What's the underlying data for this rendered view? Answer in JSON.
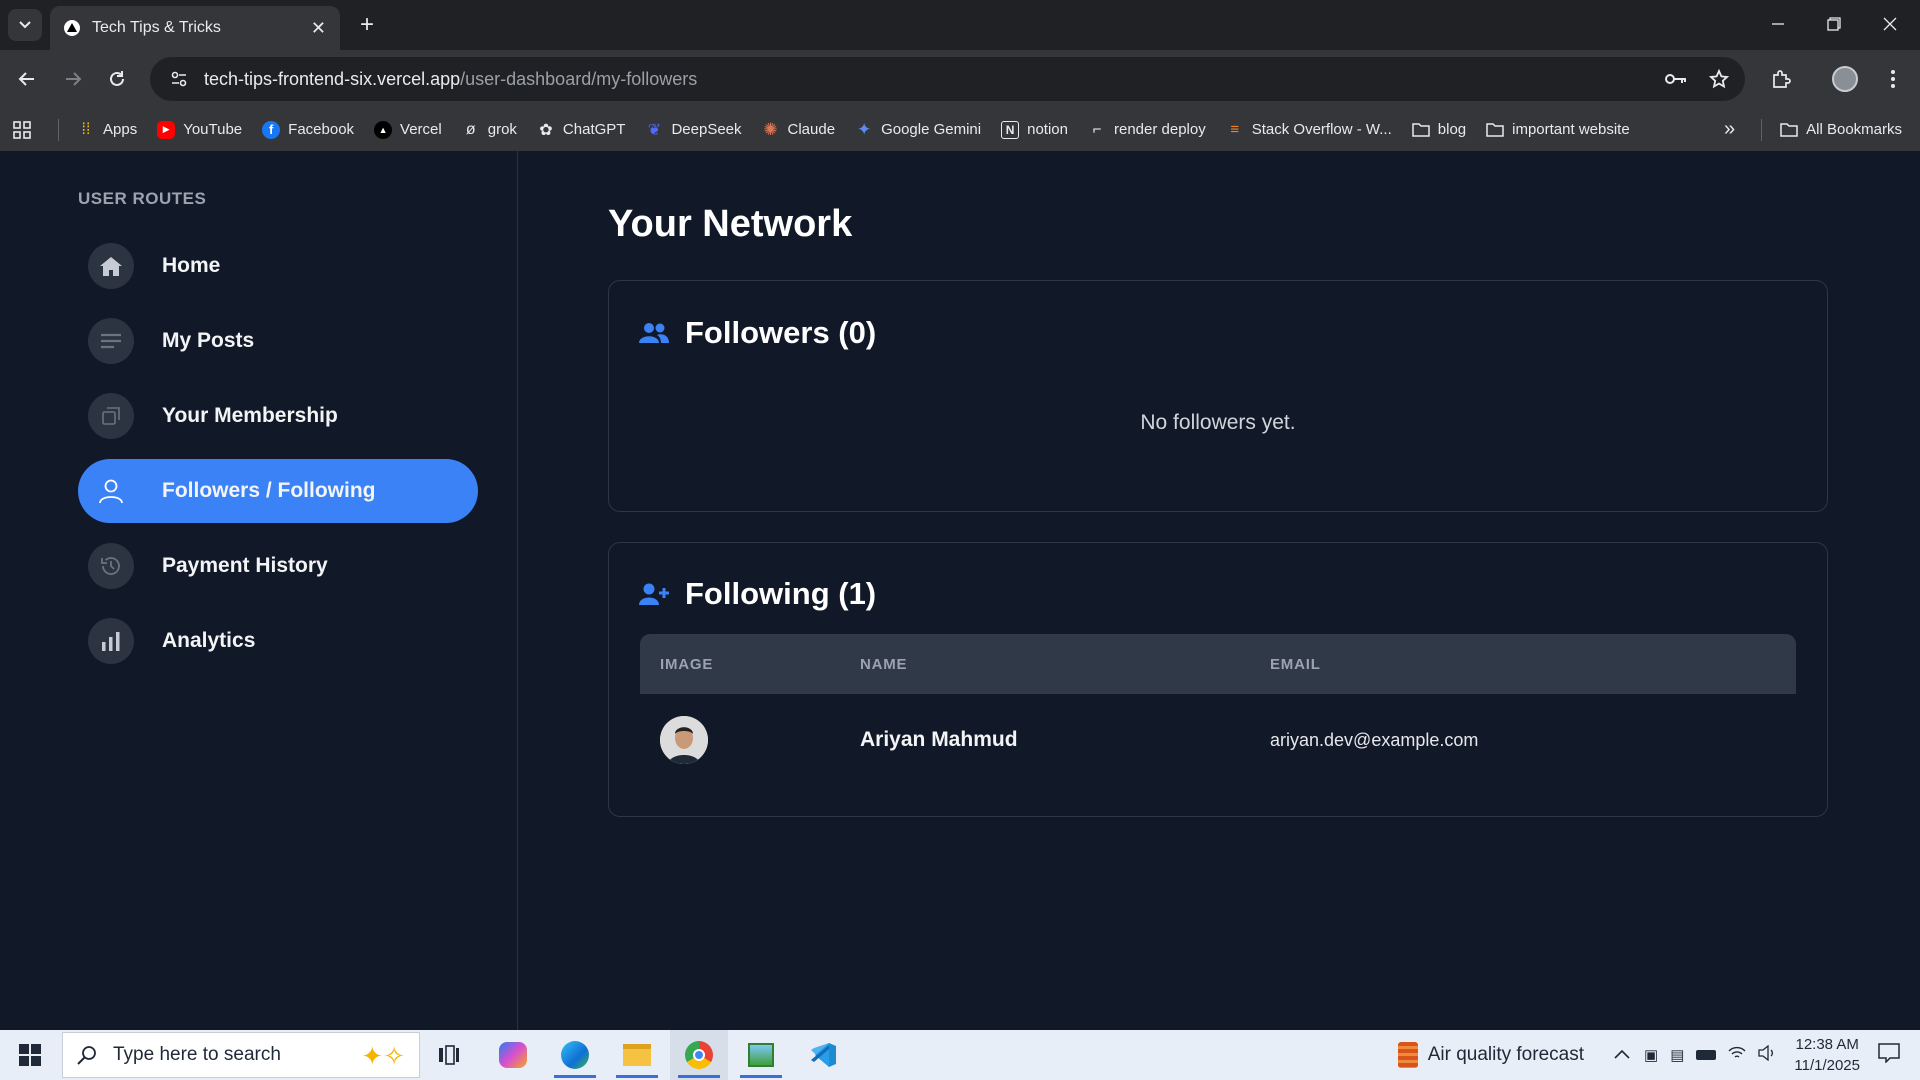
{
  "browser": {
    "tab_title": "Tech Tips & Tricks",
    "url_host": "tech-tips-frontend-six.vercel.app",
    "url_path": "/user-dashboard/my-followers",
    "bookmarks": [
      {
        "label": "Apps",
        "icon": "apps-grid-icon"
      },
      {
        "label": "YouTube",
        "icon": "youtube-icon"
      },
      {
        "label": "Facebook",
        "icon": "facebook-icon"
      },
      {
        "label": "Vercel",
        "icon": "vercel-icon"
      },
      {
        "label": "grok",
        "icon": "grok-icon"
      },
      {
        "label": "ChatGPT",
        "icon": "chatgpt-icon"
      },
      {
        "label": "DeepSeek",
        "icon": "deepseek-icon"
      },
      {
        "label": "Claude",
        "icon": "claude-icon"
      },
      {
        "label": "Google Gemini",
        "icon": "gemini-icon"
      },
      {
        "label": "notion",
        "icon": "notion-icon"
      },
      {
        "label": "render deploy",
        "icon": "render-icon"
      },
      {
        "label": "Stack Overflow - W...",
        "icon": "stackoverflow-icon"
      },
      {
        "label": "blog",
        "icon": "folder-icon"
      },
      {
        "label": "important website",
        "icon": "folder-icon"
      }
    ],
    "all_bookmarks": "All Bookmarks"
  },
  "sidebar": {
    "heading": "USER ROUTES",
    "items": [
      {
        "label": "Home",
        "icon": "home-icon",
        "active": false
      },
      {
        "label": "My Posts",
        "icon": "posts-icon",
        "active": false
      },
      {
        "label": "Your Membership",
        "icon": "membership-icon",
        "active": false
      },
      {
        "label": "Followers / Following",
        "icon": "user-icon",
        "active": true
      },
      {
        "label": "Payment History",
        "icon": "history-icon",
        "active": false
      },
      {
        "label": "Analytics",
        "icon": "analytics-icon",
        "active": false
      }
    ]
  },
  "main": {
    "title": "Your Network",
    "followers": {
      "title": "Followers (0)",
      "empty": "No followers yet."
    },
    "following": {
      "title": "Following (1)",
      "columns": [
        "IMAGE",
        "NAME",
        "EMAIL"
      ],
      "rows": [
        {
          "name": "Ariyan Mahmud",
          "email": "ariyan.dev@example.com"
        }
      ]
    }
  },
  "taskbar": {
    "search_placeholder": "Type here to search",
    "weather": "Air quality forecast",
    "time": "12:38 AM",
    "date": "11/1/2025"
  },
  "colors": {
    "accent": "#3b82f6",
    "background": "#111827",
    "icon_blue": "#3b82f6"
  }
}
